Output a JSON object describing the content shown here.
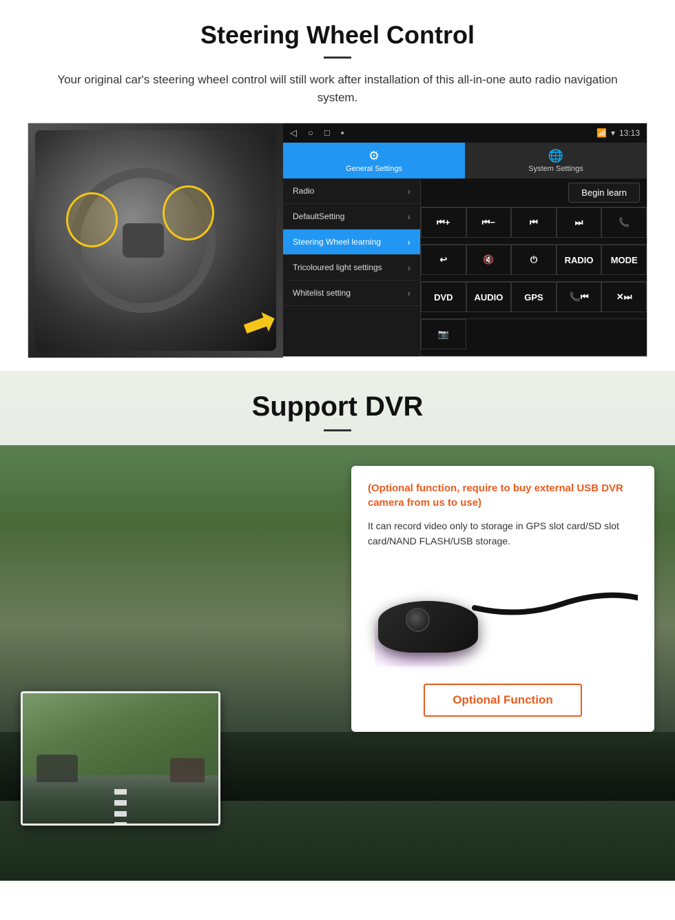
{
  "steering_section": {
    "title": "Steering Wheel Control",
    "subtitle": "Your original car's steering wheel control will still work after installation of this all-in-one auto radio navigation system.",
    "android_ui": {
      "statusbar": {
        "nav_back": "◁",
        "nav_home": "○",
        "nav_recent": "□",
        "nav_menu": "▪",
        "time": "13:13",
        "signal": "▼",
        "wifi": "▾"
      },
      "tabs": [
        {
          "label": "General Settings",
          "active": true,
          "icon": "⚙"
        },
        {
          "label": "System Settings",
          "active": false,
          "icon": "🌐"
        }
      ],
      "menu_items": [
        {
          "label": "Radio",
          "active": false
        },
        {
          "label": "DefaultSetting",
          "active": false
        },
        {
          "label": "Steering Wheel learning",
          "active": true
        },
        {
          "label": "Tricoloured light settings",
          "active": false
        },
        {
          "label": "Whitelist setting",
          "active": false
        }
      ],
      "begin_learn_label": "Begin learn",
      "control_buttons": [
        [
          "⏮+",
          "⏮−",
          "⏮⏮",
          "⏭⏭",
          "📞"
        ],
        [
          "↩",
          "🔇",
          "⏻",
          "RADIO",
          "MODE"
        ],
        [
          "DVD",
          "AUDIO",
          "GPS",
          "📞⏮",
          "✕⏭"
        ],
        [
          "📷"
        ]
      ]
    }
  },
  "dvr_section": {
    "title": "Support DVR",
    "optional_text": "(Optional function, require to buy external USB DVR camera from us to use)",
    "description": "It can record video only to storage in GPS slot card/SD slot card/NAND FLASH/USB storage.",
    "optional_button_label": "Optional Function"
  }
}
